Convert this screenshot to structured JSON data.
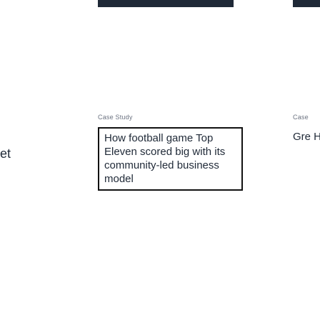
{
  "previous_card": {
    "partial_text": "et"
  },
  "main_card": {
    "eyebrow": "Case Study",
    "title": "How football game Top Eleven scored big with its community-led business model"
  },
  "next_card": {
    "eyebrow": "Case",
    "title": "Gre Hot trav"
  },
  "colors": {
    "text": "#1f2937",
    "eyebrow": "#6b7280",
    "focus_border": "#111111",
    "image_bar": "#1f2937"
  }
}
